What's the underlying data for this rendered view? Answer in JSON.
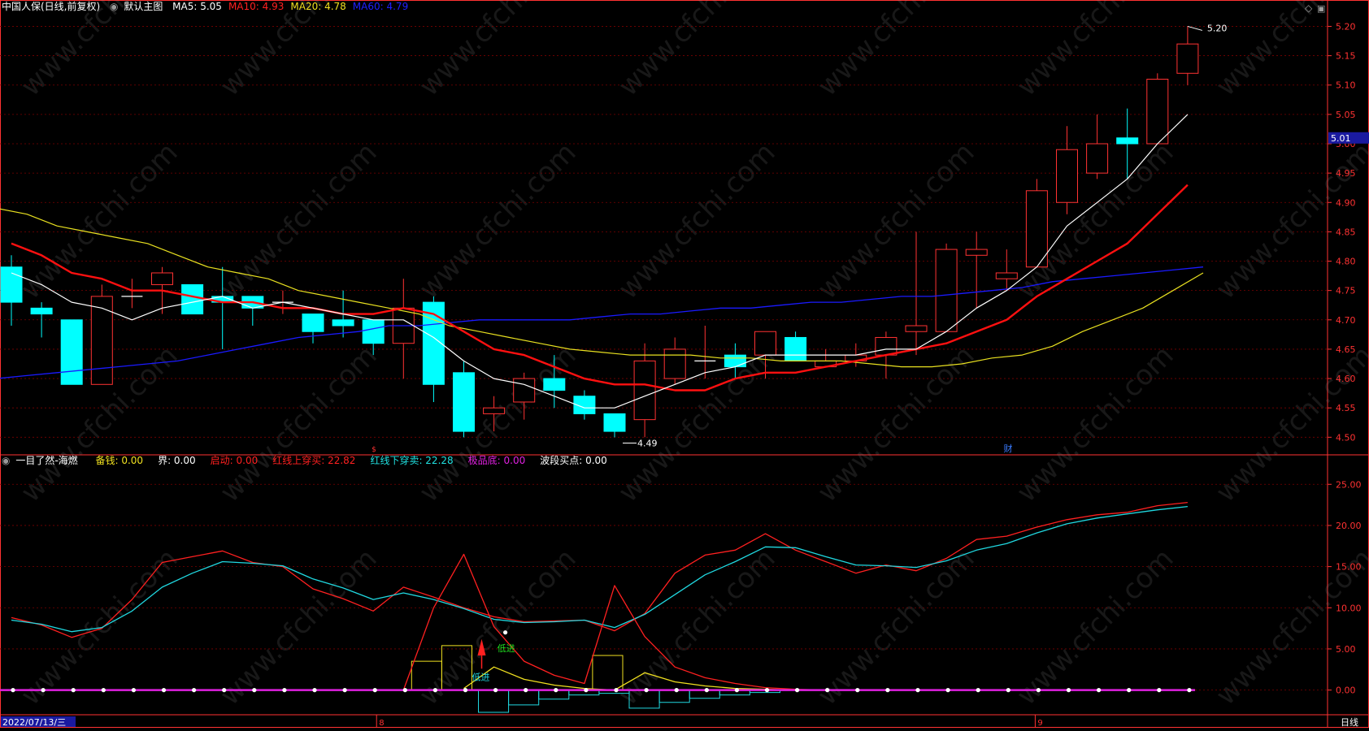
{
  "header": {
    "stock": "中国人保(日线,前复权)",
    "main_chart": "默认主图",
    "ma": [
      {
        "label": "MA5: 5.05",
        "color": "#ffffff"
      },
      {
        "label": "MA10: 4.93",
        "color": "#ff2020"
      },
      {
        "label": "MA20: 4.78",
        "color": "#f0e020"
      },
      {
        "label": "MA60: 4.79",
        "color": "#2020ff"
      }
    ]
  },
  "indicator_header": {
    "name": "一目了然-海燃",
    "items": [
      {
        "label": "备钱: 0.00",
        "color": "#f0e020"
      },
      {
        "label": "界: 0.00",
        "color": "#ffffff"
      },
      {
        "label": "启动: 0.00",
        "color": "#ff2020"
      },
      {
        "label": "红线上穿买: 22.82",
        "color": "#ff2020"
      },
      {
        "label": "红线下穿卖: 22.28",
        "color": "#20e0e0"
      },
      {
        "label": "极品底: 0.00",
        "color": "#e020e0"
      },
      {
        "label": "波段买点: 0.00",
        "color": "#ffffff"
      }
    ]
  },
  "annotations": {
    "high_label": "5.20",
    "low_label": "4.49",
    "fin_marker": "财",
    "low_entry_1": "低进",
    "low_entry_2": "低进",
    "current_price": "5.01"
  },
  "bottom_bar": {
    "date": "2022/07/13/三",
    "month_8": "8",
    "month_9": "9",
    "period": "日线"
  },
  "colors": {
    "up": "#ff3232",
    "down": "#00ffff",
    "ma5": "#ffffff",
    "ma10": "#ff1010",
    "ma20": "#e8e020",
    "ma60": "#1a1aff",
    "grid": "#7a0000",
    "axis": "#ff3232"
  },
  "chart_data": [
    {
      "type": "candlestick",
      "ylim": [
        4.47,
        5.22
      ],
      "y_ticks": [
        4.5,
        4.55,
        4.6,
        4.65,
        4.7,
        4.75,
        4.8,
        4.85,
        4.9,
        4.95,
        5.0,
        5.05,
        5.1,
        5.15,
        5.2
      ],
      "y_tick_labels": [
        "4.50",
        "4.55",
        "4.60",
        "4.65",
        "4.70",
        "4.75",
        "4.80",
        "4.85",
        "4.90",
        "4.95",
        "5.00",
        "5.05",
        "5.10",
        "5.15",
        "5.20"
      ],
      "candles": [
        {
          "o": 4.79,
          "h": 4.81,
          "l": 4.69,
          "c": 4.73
        },
        {
          "o": 4.72,
          "h": 4.73,
          "l": 4.67,
          "c": 4.71
        },
        {
          "o": 4.7,
          "h": 4.7,
          "l": 4.59,
          "c": 4.59
        },
        {
          "o": 4.59,
          "h": 4.76,
          "l": 4.59,
          "c": 4.74
        },
        {
          "o": 4.74,
          "h": 4.77,
          "l": 4.72,
          "c": 4.74
        },
        {
          "o": 4.76,
          "h": 4.79,
          "l": 4.71,
          "c": 4.78
        },
        {
          "o": 4.76,
          "h": 4.76,
          "l": 4.71,
          "c": 4.71
        },
        {
          "o": 4.74,
          "h": 4.79,
          "l": 4.65,
          "c": 4.73
        },
        {
          "o": 4.74,
          "h": 4.74,
          "l": 4.69,
          "c": 4.72
        },
        {
          "o": 4.73,
          "h": 4.75,
          "l": 4.71,
          "c": 4.73
        },
        {
          "o": 4.71,
          "h": 4.71,
          "l": 4.66,
          "c": 4.68
        },
        {
          "o": 4.7,
          "h": 4.75,
          "l": 4.67,
          "c": 4.69
        },
        {
          "o": 4.7,
          "h": 4.7,
          "l": 4.64,
          "c": 4.66
        },
        {
          "o": 4.66,
          "h": 4.77,
          "l": 4.6,
          "c": 4.72
        },
        {
          "o": 4.73,
          "h": 4.74,
          "l": 4.56,
          "c": 4.59
        },
        {
          "o": 4.61,
          "h": 4.63,
          "l": 4.5,
          "c": 4.51
        },
        {
          "o": 4.54,
          "h": 4.57,
          "l": 4.51,
          "c": 4.55
        },
        {
          "o": 4.56,
          "h": 4.61,
          "l": 4.53,
          "c": 4.6
        },
        {
          "o": 4.6,
          "h": 4.64,
          "l": 4.55,
          "c": 4.58
        },
        {
          "o": 4.57,
          "h": 4.58,
          "l": 4.53,
          "c": 4.54
        },
        {
          "o": 4.54,
          "h": 4.54,
          "l": 4.5,
          "c": 4.51
        },
        {
          "o": 4.53,
          "h": 4.66,
          "l": 4.5,
          "c": 4.63
        },
        {
          "o": 4.6,
          "h": 4.67,
          "l": 4.59,
          "c": 4.65
        },
        {
          "o": 4.63,
          "h": 4.69,
          "l": 4.6,
          "c": 4.63
        },
        {
          "o": 4.64,
          "h": 4.66,
          "l": 4.6,
          "c": 4.62
        },
        {
          "o": 4.64,
          "h": 4.68,
          "l": 4.6,
          "c": 4.68
        },
        {
          "o": 4.67,
          "h": 4.68,
          "l": 4.63,
          "c": 4.63
        },
        {
          "o": 4.62,
          "h": 4.65,
          "l": 4.62,
          "c": 4.63
        },
        {
          "o": 4.63,
          "h": 4.66,
          "l": 4.62,
          "c": 4.64
        },
        {
          "o": 4.64,
          "h": 4.68,
          "l": 4.6,
          "c": 4.67
        },
        {
          "o": 4.68,
          "h": 4.85,
          "l": 4.64,
          "c": 4.69
        },
        {
          "o": 4.68,
          "h": 4.83,
          "l": 4.68,
          "c": 4.82
        },
        {
          "o": 4.81,
          "h": 4.85,
          "l": 4.72,
          "c": 4.82
        },
        {
          "o": 4.77,
          "h": 4.82,
          "l": 4.75,
          "c": 4.78
        },
        {
          "o": 4.79,
          "h": 4.94,
          "l": 4.79,
          "c": 4.92
        },
        {
          "o": 4.9,
          "h": 5.03,
          "l": 4.88,
          "c": 4.99
        },
        {
          "o": 4.95,
          "h": 5.05,
          "l": 4.94,
          "c": 5.0
        },
        {
          "o": 5.01,
          "h": 5.06,
          "l": 4.94,
          "c": 5.0
        },
        {
          "o": 5.0,
          "h": 5.12,
          "l": 5.0,
          "c": 5.11
        },
        {
          "o": 5.12,
          "h": 5.2,
          "l": 5.1,
          "c": 5.17
        }
      ],
      "ma5": [
        4.78,
        4.76,
        4.73,
        4.72,
        4.7,
        4.72,
        4.73,
        4.74,
        4.72,
        4.73,
        4.72,
        4.71,
        4.7,
        4.7,
        4.67,
        4.63,
        4.6,
        4.59,
        4.57,
        4.55,
        4.55,
        4.57,
        4.59,
        4.61,
        4.62,
        4.64,
        4.64,
        4.64,
        4.64,
        4.65,
        4.65,
        4.68,
        4.72,
        4.75,
        4.79,
        4.86,
        4.9,
        4.94,
        5.0,
        5.05
      ],
      "ma10": [
        4.83,
        4.81,
        4.78,
        4.77,
        4.75,
        4.75,
        4.74,
        4.73,
        4.73,
        4.72,
        4.72,
        4.71,
        4.71,
        4.72,
        4.71,
        4.68,
        4.65,
        4.64,
        4.62,
        4.6,
        4.59,
        4.59,
        4.58,
        4.58,
        4.6,
        4.61,
        4.61,
        4.62,
        4.63,
        4.64,
        4.65,
        4.66,
        4.68,
        4.7,
        4.74,
        4.77,
        4.8,
        4.83,
        4.88,
        4.93
      ],
      "ma20": [
        4.89,
        4.88,
        4.86,
        4.85,
        4.84,
        4.83,
        4.81,
        4.79,
        4.78,
        4.77,
        4.75,
        4.74,
        4.73,
        4.72,
        4.71,
        4.69,
        4.68,
        4.67,
        4.66,
        4.65,
        4.645,
        4.64,
        4.64,
        4.64,
        4.635,
        4.635,
        4.63,
        4.63,
        4.63,
        4.625,
        4.62,
        4.62,
        4.625,
        4.635,
        4.64,
        4.655,
        4.68,
        4.7,
        4.72,
        4.75,
        4.78
      ],
      "ma60": [
        4.6,
        4.605,
        4.61,
        4.615,
        4.62,
        4.625,
        4.63,
        4.64,
        4.65,
        4.66,
        4.67,
        4.675,
        4.68,
        4.69,
        4.69,
        4.695,
        4.7,
        4.7,
        4.7,
        4.7,
        4.705,
        4.71,
        4.71,
        4.715,
        4.72,
        4.72,
        4.725,
        4.73,
        4.73,
        4.735,
        4.74,
        4.74,
        4.745,
        4.75,
        4.755,
        4.765,
        4.77,
        4.775,
        4.78,
        4.785,
        4.79
      ]
    },
    {
      "type": "line",
      "ylim": [
        -3.0,
        27.0
      ],
      "y_ticks": [
        0,
        5,
        10,
        15,
        20,
        25
      ],
      "y_tick_labels": [
        "0.00",
        "5.00",
        "10.00",
        "15.00",
        "20.00",
        "25.00"
      ],
      "series": [
        {
          "name": "红线",
          "color": "#ff2020",
          "values": [
            8.8,
            7.9,
            6.4,
            7.5,
            11.0,
            15.5,
            16.2,
            16.9,
            15.5,
            15.0,
            12.3,
            11.1,
            9.6,
            12.5,
            11.3,
            10.0,
            8.9,
            8.3,
            8.4,
            8.5,
            7.2,
            9.3,
            14.2,
            16.4,
            17.0,
            19.0,
            17.0,
            15.6,
            14.2,
            15.2,
            14.5,
            16.0,
            18.3,
            18.7,
            19.8,
            20.7,
            21.3,
            21.6,
            22.4,
            22.8
          ]
        },
        {
          "name": "蓝线",
          "color": "#20d8e0",
          "values": [
            8.5,
            8.0,
            7.1,
            7.6,
            9.6,
            12.5,
            14.2,
            15.6,
            15.4,
            15.1,
            13.5,
            12.4,
            11.0,
            11.8,
            11.0,
            9.9,
            8.6,
            8.2,
            8.3,
            8.5,
            7.6,
            9.2,
            11.6,
            14.0,
            15.6,
            17.4,
            17.3,
            16.2,
            15.2,
            15.1,
            14.9,
            15.7,
            17.0,
            17.8,
            19.1,
            20.2,
            20.9,
            21.4,
            21.9,
            22.3
          ]
        },
        {
          "name": "红峰",
          "color": "#ff2020",
          "values": [
            null,
            null,
            null,
            null,
            null,
            null,
            null,
            null,
            null,
            null,
            null,
            null,
            null,
            0,
            10.0,
            16.5,
            7.7,
            3.5,
            1.8,
            0.8,
            12.7,
            6.5,
            2.8,
            1.5,
            0.8,
            0.3,
            0.1,
            0,
            null,
            null,
            null,
            null,
            null,
            null,
            null,
            null,
            null,
            null,
            null,
            null
          ]
        },
        {
          "name": "黄线",
          "color": "#f0e020",
          "values": [
            null,
            null,
            null,
            null,
            null,
            null,
            null,
            null,
            null,
            null,
            null,
            null,
            null,
            null,
            null,
            0.2,
            2.8,
            1.3,
            0.6,
            0.2,
            0,
            2.1,
            1.0,
            0.5,
            0.2,
            0.1,
            0,
            null,
            null,
            null,
            null,
            null,
            null,
            null,
            null,
            null,
            null,
            null,
            null,
            null
          ]
        }
      ],
      "yellow_boxes": [
        {
          "from": 13,
          "to": 14,
          "value": 3.5
        },
        {
          "from": 14,
          "to": 15,
          "value": 5.4
        },
        {
          "from": 19,
          "to": 20,
          "value": 4.2
        }
      ],
      "cyan_steps": [
        {
          "from": 15,
          "to": 16,
          "value": -2.7
        },
        {
          "from": 16,
          "to": 17,
          "value": -1.8
        },
        {
          "from": 17,
          "to": 18,
          "value": -1.1
        },
        {
          "from": 18,
          "to": 19,
          "value": -0.6
        },
        {
          "from": 19,
          "to": 20,
          "value": -0.4
        },
        {
          "from": 20,
          "to": 21,
          "value": -2.2
        },
        {
          "from": 21,
          "to": 22,
          "value": -1.5
        },
        {
          "from": 22,
          "to": 23,
          "value": -1.0
        },
        {
          "from": 23,
          "to": 24,
          "value": -0.6
        },
        {
          "from": 24,
          "to": 25,
          "value": -0.3
        }
      ],
      "baseline_value": 0,
      "baseline_color": "#e020e0"
    }
  ]
}
